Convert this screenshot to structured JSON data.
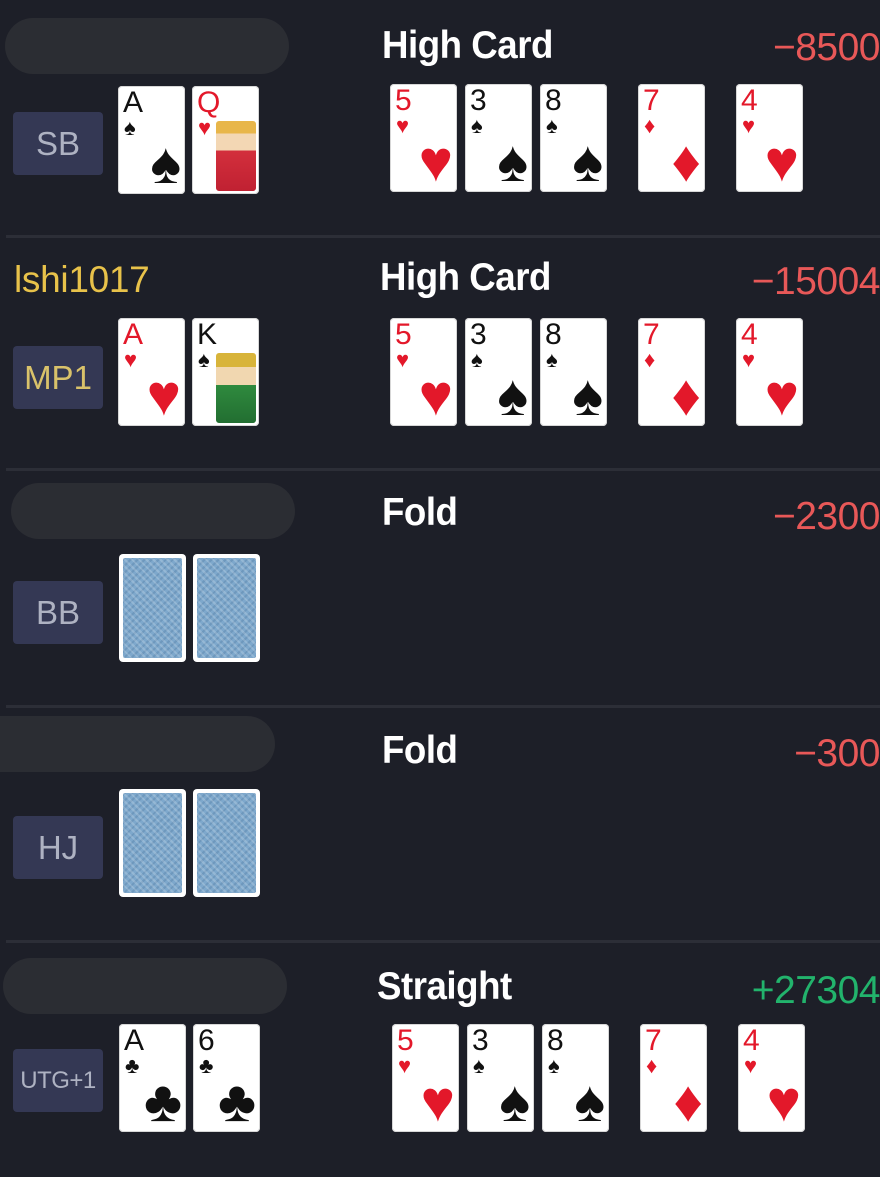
{
  "players": [
    {
      "name": "",
      "position": "SB",
      "result": "High Card",
      "amount": "−8500",
      "amount_sign": "neg",
      "hole_cards": [
        {
          "rank": "A",
          "suit": "♠",
          "color": "black",
          "face": ""
        },
        {
          "rank": "Q",
          "suit": "♥",
          "color": "red",
          "face": "queen"
        }
      ],
      "board": [
        {
          "rank": "5",
          "suit": "♥",
          "color": "red"
        },
        {
          "rank": "3",
          "suit": "♠",
          "color": "black"
        },
        {
          "rank": "8",
          "suit": "♠",
          "color": "black"
        },
        {
          "rank": "7",
          "suit": "♦",
          "color": "red"
        },
        {
          "rank": "4",
          "suit": "♥",
          "color": "red"
        }
      ]
    },
    {
      "name": "lshi1017",
      "position": "MP1",
      "result": "High Card",
      "amount": "−15004",
      "amount_sign": "neg",
      "hole_cards": [
        {
          "rank": "A",
          "suit": "♥",
          "color": "red",
          "face": ""
        },
        {
          "rank": "K",
          "suit": "♠",
          "color": "black",
          "face": "king"
        }
      ],
      "board": [
        {
          "rank": "5",
          "suit": "♥",
          "color": "red"
        },
        {
          "rank": "3",
          "suit": "♠",
          "color": "black"
        },
        {
          "rank": "8",
          "suit": "♠",
          "color": "black"
        },
        {
          "rank": "7",
          "suit": "♦",
          "color": "red"
        },
        {
          "rank": "4",
          "suit": "♥",
          "color": "red"
        }
      ]
    },
    {
      "name": "",
      "position": "BB",
      "result": "Fold",
      "amount": "−2300",
      "amount_sign": "neg",
      "hole_cards": [],
      "board": []
    },
    {
      "name": "",
      "position": "HJ",
      "result": "Fold",
      "amount": "−300",
      "amount_sign": "neg",
      "hole_cards": [],
      "board": []
    },
    {
      "name": "",
      "position": "UTG+1",
      "result": "Straight",
      "amount": "+27304",
      "amount_sign": "pos",
      "hole_cards": [
        {
          "rank": "A",
          "suit": "♣",
          "color": "black",
          "face": ""
        },
        {
          "rank": "6",
          "suit": "♣",
          "color": "black",
          "face": ""
        }
      ],
      "board": [
        {
          "rank": "5",
          "suit": "♥",
          "color": "red"
        },
        {
          "rank": "3",
          "suit": "♠",
          "color": "black"
        },
        {
          "rank": "8",
          "suit": "♠",
          "color": "black"
        },
        {
          "rank": "7",
          "suit": "♦",
          "color": "red"
        },
        {
          "rank": "4",
          "suit": "♥",
          "color": "red"
        }
      ]
    }
  ]
}
